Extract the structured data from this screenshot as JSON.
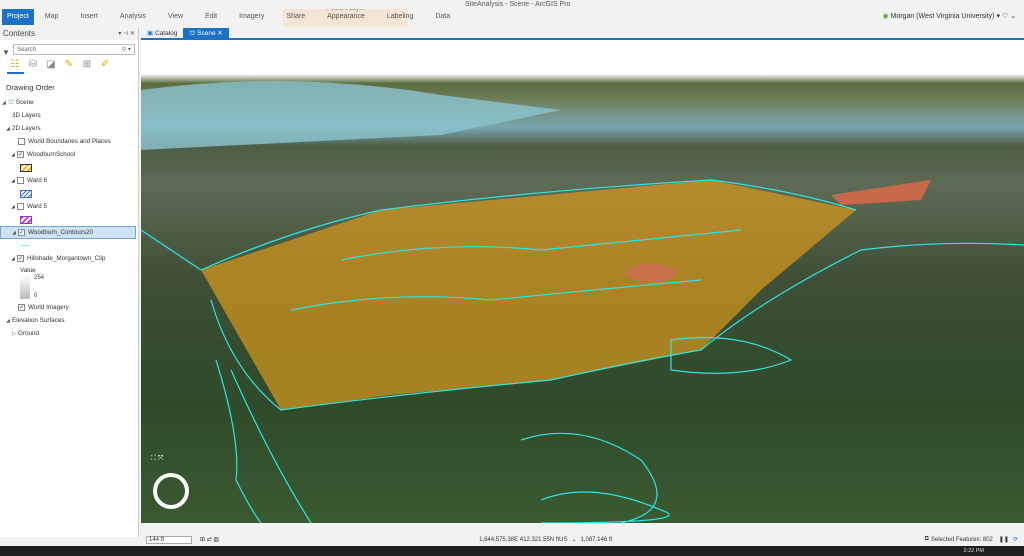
{
  "window": {
    "title": "SiteAnalysis - Scene - ArcGIS Pro"
  },
  "ribbon": {
    "tabs": [
      "Project",
      "Map",
      "Insert",
      "Analysis",
      "View",
      "Edit",
      "Imagery",
      "Share"
    ],
    "contextual_group": "Feature Layer",
    "contextual_tabs": [
      "Appearance",
      "Labeling",
      "Data"
    ],
    "user": "Morgan (West Virginia University)"
  },
  "contents": {
    "title": "Contents",
    "search_placeholder": "Search",
    "section": "Drawing Order",
    "tree": {
      "scene": "Scene",
      "layers3d": "3D Layers",
      "layers2d": "2D Layers",
      "world_boundaries": "World Boundaries and Places",
      "woodburn_school": "WoodburnSchool",
      "ward6": "Ward 6",
      "ward5": "Ward 5",
      "contours": "Woodburn_Contours20",
      "hillshade": "Hillshade_Morgantown_Clip",
      "value_label": "Value",
      "value_max": "254",
      "value_min": "0",
      "world_imagery": "World Imagery",
      "elevation": "Elevation Surfaces",
      "ground": "Ground"
    }
  },
  "doc_tabs": [
    "Catalog",
    "Scene"
  ],
  "status": {
    "scale": "144 ft",
    "coords": "1,844,575.38E 412,321.55N ftUS",
    "elevation": "1,087.146 ft",
    "selected": "Selected Features: 802"
  },
  "taskbar": {
    "clock": "2:22 PM"
  },
  "colors": {
    "accent": "#1c73c6",
    "contour": "#2ee6e6",
    "parcel": "#d89a1c"
  }
}
